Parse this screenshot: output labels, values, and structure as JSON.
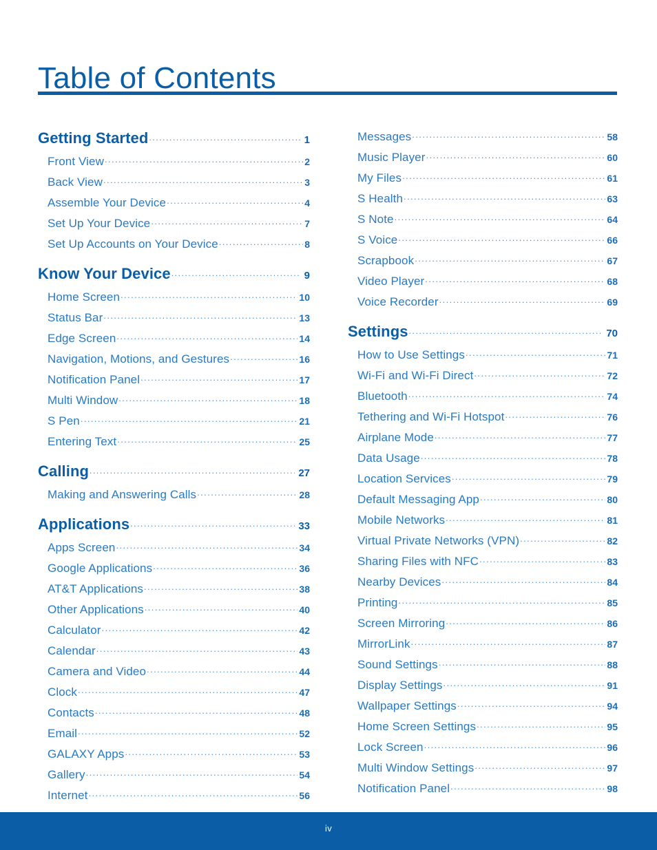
{
  "document": {
    "title": "Table of Contents",
    "footer_page_label": "iv"
  },
  "colors": {
    "heading_blue": "#0b5ea6",
    "entry_blue": "#2a7ac2",
    "rule_blue": "#0b5ea6",
    "footer_bar_blue": "#0b5ea6",
    "footer_text": "#ffffff"
  },
  "columns": {
    "left": [
      {
        "level": 1,
        "label": "Getting Started",
        "page": "1"
      },
      {
        "level": 2,
        "label": "Front View",
        "page": "2"
      },
      {
        "level": 2,
        "label": "Back View",
        "page": "3"
      },
      {
        "level": 2,
        "label": "Assemble Your Device",
        "page": "4"
      },
      {
        "level": 2,
        "label": "Set Up Your Device",
        "page": "7"
      },
      {
        "level": 2,
        "label": "Set Up Accounts on Your Device",
        "page": "8"
      },
      {
        "level": 1,
        "label": "Know Your Device",
        "page": "9"
      },
      {
        "level": 2,
        "label": "Home Screen",
        "page": "10"
      },
      {
        "level": 2,
        "label": "Status Bar",
        "page": "13"
      },
      {
        "level": 2,
        "label": "Edge Screen",
        "page": "14"
      },
      {
        "level": 2,
        "label": "Navigation, Motions, and Gestures",
        "page": "16"
      },
      {
        "level": 2,
        "label": "Notification Panel",
        "page": "17"
      },
      {
        "level": 2,
        "label": "Multi Window",
        "page": "18"
      },
      {
        "level": 2,
        "label": "S Pen",
        "page": "21"
      },
      {
        "level": 2,
        "label": "Entering Text",
        "page": "25"
      },
      {
        "level": 1,
        "label": "Calling",
        "page": "27"
      },
      {
        "level": 2,
        "label": "Making and Answering Calls",
        "page": "28"
      },
      {
        "level": 1,
        "label": "Applications",
        "page": "33"
      },
      {
        "level": 2,
        "label": "Apps Screen",
        "page": "34"
      },
      {
        "level": 2,
        "label": "Google Applications",
        "page": "36"
      },
      {
        "level": 2,
        "label": "AT&T Applications",
        "page": "38"
      },
      {
        "level": 2,
        "label": "Other Applications",
        "page": "40"
      },
      {
        "level": 2,
        "label": "Calculator",
        "page": "42"
      },
      {
        "level": 2,
        "label": "Calendar",
        "page": "43"
      },
      {
        "level": 2,
        "label": "Camera and Video",
        "page": "44"
      },
      {
        "level": 2,
        "label": "Clock",
        "page": "47"
      },
      {
        "level": 2,
        "label": "Contacts",
        "page": "48"
      },
      {
        "level": 2,
        "label": "Email",
        "page": "52"
      },
      {
        "level": 2,
        "label": "GALAXY Apps",
        "page": "53"
      },
      {
        "level": 2,
        "label": "Gallery",
        "page": "54"
      },
      {
        "level": 2,
        "label": "Internet",
        "page": "56"
      }
    ],
    "right": [
      {
        "level": 2,
        "label": "Messages",
        "page": "58"
      },
      {
        "level": 2,
        "label": "Music Player",
        "page": "60"
      },
      {
        "level": 2,
        "label": "My Files",
        "page": "61"
      },
      {
        "level": 2,
        "label": "S Health",
        "page": "63"
      },
      {
        "level": 2,
        "label": "S Note",
        "page": "64"
      },
      {
        "level": 2,
        "label": "S Voice",
        "page": "66"
      },
      {
        "level": 2,
        "label": "Scrapbook",
        "page": "67"
      },
      {
        "level": 2,
        "label": "Video Player",
        "page": "68"
      },
      {
        "level": 2,
        "label": "Voice Recorder",
        "page": "69"
      },
      {
        "level": 1,
        "label": "Settings",
        "page": "70"
      },
      {
        "level": 2,
        "label": "How to Use Settings",
        "page": "71"
      },
      {
        "level": 2,
        "label": "Wi-Fi and Wi-Fi Direct",
        "page": "72"
      },
      {
        "level": 2,
        "label": "Bluetooth",
        "page": "74"
      },
      {
        "level": 2,
        "label": "Tethering and Wi-Fi Hotspot",
        "page": "76"
      },
      {
        "level": 2,
        "label": "Airplane Mode",
        "page": "77"
      },
      {
        "level": 2,
        "label": "Data Usage",
        "page": "78"
      },
      {
        "level": 2,
        "label": "Location Services",
        "page": "79"
      },
      {
        "level": 2,
        "label": "Default Messaging App",
        "page": "80"
      },
      {
        "level": 2,
        "label": "Mobile Networks",
        "page": "81"
      },
      {
        "level": 2,
        "label": "Virtual Private Networks (VPN)",
        "page": "82"
      },
      {
        "level": 2,
        "label": "Sharing Files with NFC",
        "page": "83"
      },
      {
        "level": 2,
        "label": "Nearby Devices",
        "page": "84"
      },
      {
        "level": 2,
        "label": "Printing",
        "page": "85"
      },
      {
        "level": 2,
        "label": "Screen Mirroring",
        "page": "86"
      },
      {
        "level": 2,
        "label": "MirrorLink",
        "page": "87"
      },
      {
        "level": 2,
        "label": "Sound Settings",
        "page": "88"
      },
      {
        "level": 2,
        "label": "Display Settings",
        "page": "91"
      },
      {
        "level": 2,
        "label": "Wallpaper Settings",
        "page": "94"
      },
      {
        "level": 2,
        "label": "Home Screen Settings",
        "page": "95"
      },
      {
        "level": 2,
        "label": "Lock Screen",
        "page": "96"
      },
      {
        "level": 2,
        "label": "Multi Window Settings",
        "page": "97"
      },
      {
        "level": 2,
        "label": "Notification Panel",
        "page": "98"
      }
    ]
  }
}
